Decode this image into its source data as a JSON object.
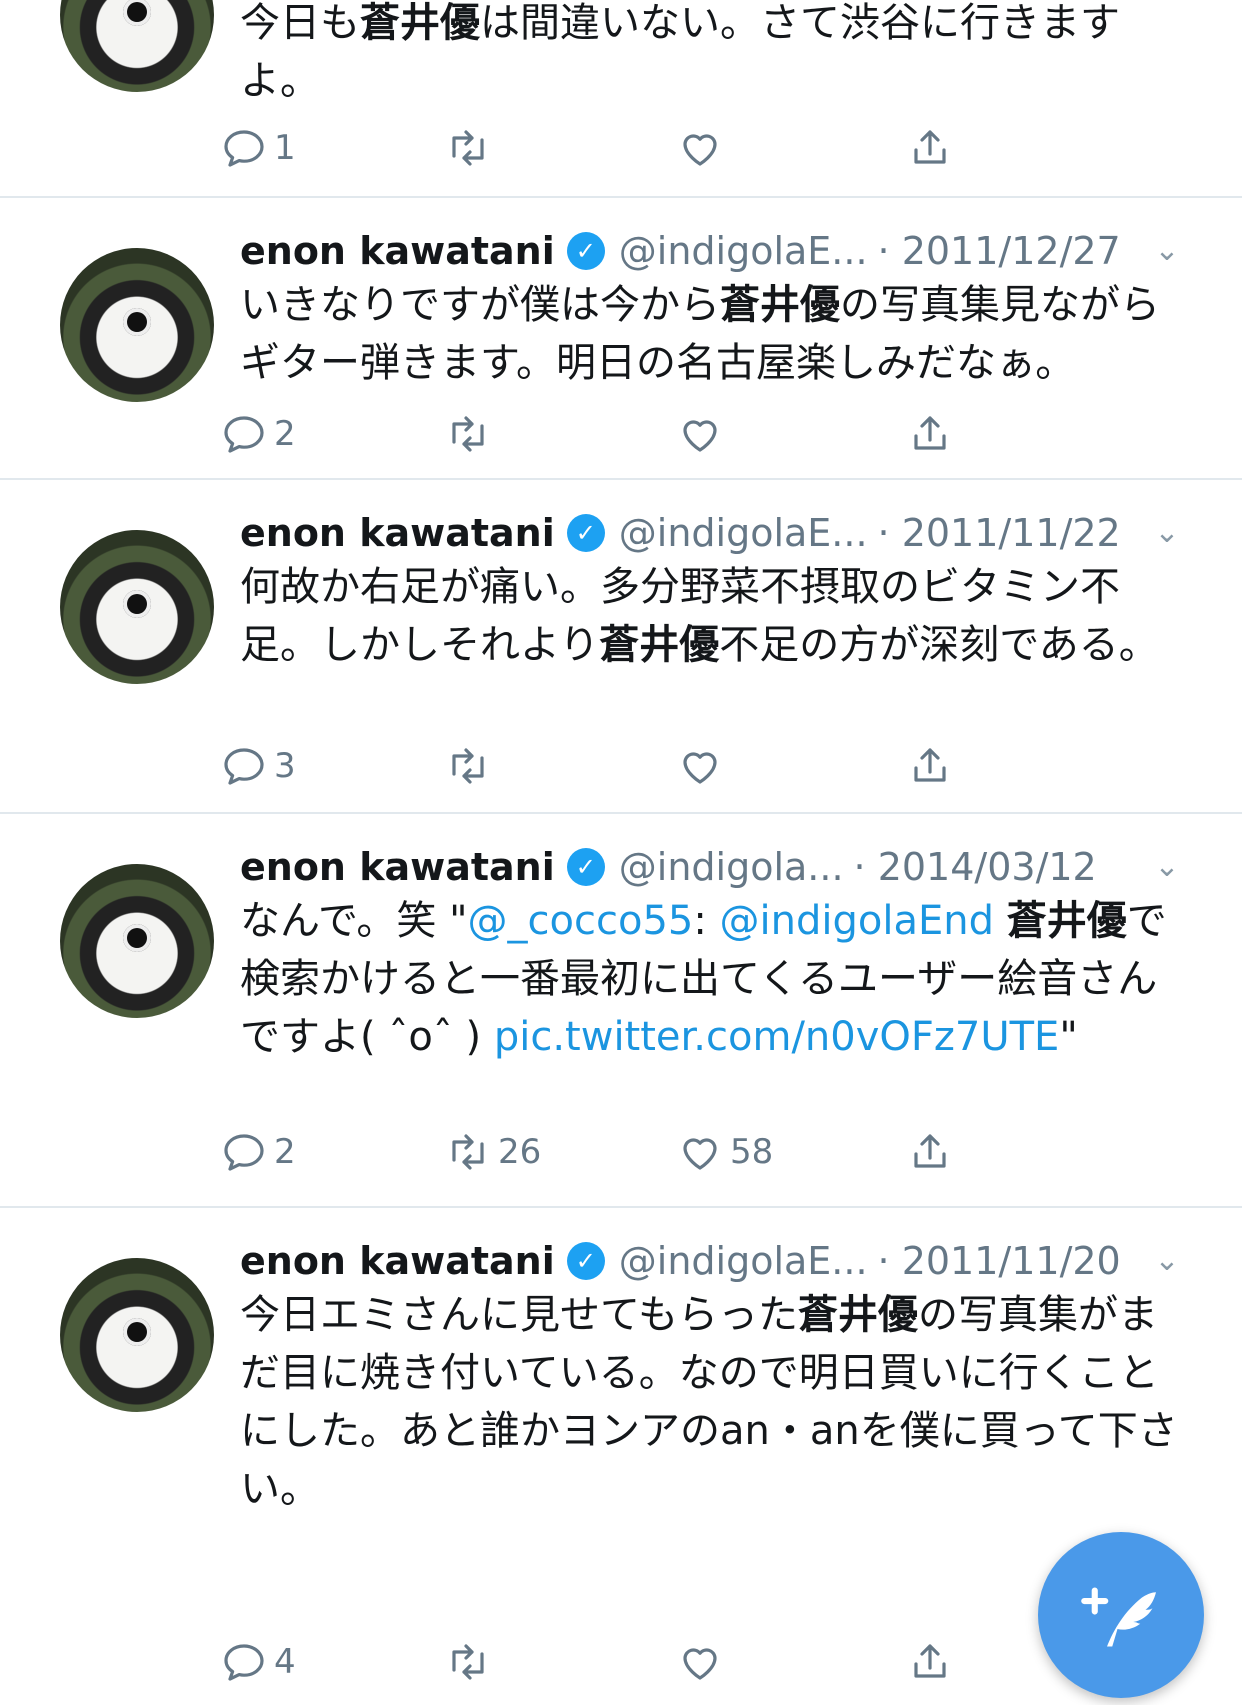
{
  "tweet0": {
    "text_a": "今日も",
    "text_b": "蒼井優",
    "text_c": "は間違いない。さて渋谷に行きますよ。",
    "reply_count": "1",
    "retweet_count": "",
    "like_count": ""
  },
  "tweet1": {
    "name": "enon kawatani",
    "handle": "@indigolaE...",
    "date": "· 2011/12/27",
    "text_a": "いきなりですが僕は今から",
    "text_b": "蒼井優",
    "text_c": "の写真集見ながらギター弾きます。明日の名古屋楽しみだなぁ。",
    "reply_count": "2",
    "retweet_count": "",
    "like_count": ""
  },
  "tweet2": {
    "name": "enon kawatani",
    "handle": "@indigolaE...",
    "date": "· 2011/11/22",
    "text_a": "何故か右足が痛い。多分野菜不摂取のビタミン不足。しかしそれより",
    "text_b": "蒼井優",
    "text_c": "不足の方が深刻である。",
    "reply_count": "3",
    "retweet_count": "",
    "like_count": ""
  },
  "tweet3": {
    "name": "enon kawatani",
    "handle": "@indigola...",
    "date": "· 2014/03/12",
    "text_a": "なんで。笑 \"",
    "mention1": "@_cocco55",
    "text_colon": ": ",
    "mention2": "@indigolaEnd",
    "text_space": " ",
    "text_b": "蒼井優",
    "text_c": "で検索かけると一番最初に出てくるユーザー絵音さんですよ( ˆoˆ ) ",
    "link": "pic.twitter.com/n0vOFz7UTE",
    "text_end": "\"",
    "reply_count": "2",
    "retweet_count": "26",
    "like_count": "58"
  },
  "tweet4": {
    "name": "enon kawatani",
    "handle": "@indigolaE...",
    "date": "· 2011/11/20",
    "text_a": "今日エミさんに見せてもらった",
    "text_b": "蒼井優",
    "text_c": "の写真集がまだ目に焼き付いている。なので明日買いに行くことにした。あと誰かヨンアのan・anを僕に買って下さい。",
    "reply_count": "4",
    "retweet_count": "",
    "like_count": ""
  },
  "icons": {
    "reply": "reply-icon",
    "retweet": "retweet-icon",
    "like": "heart-icon",
    "share": "share-icon",
    "verified": "verified-badge-icon",
    "compose": "compose-tweet-icon"
  },
  "colors": {
    "link": "#1b95e0",
    "verified": "#1da1f2",
    "compose_button": "#4a99e9",
    "secondary_text": "#657786"
  }
}
